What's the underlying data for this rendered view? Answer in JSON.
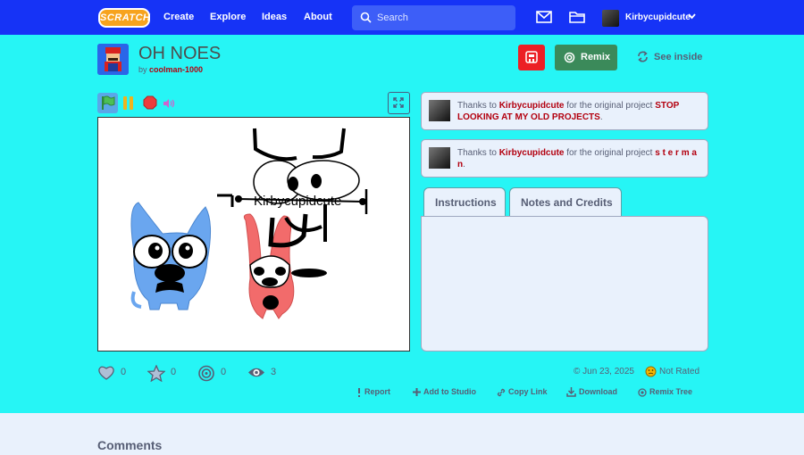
{
  "nav": {
    "logo": "SCRATCH",
    "links": [
      "Create",
      "Explore",
      "Ideas",
      "About"
    ],
    "search_placeholder": "Search",
    "username": "Kirbycupidcute"
  },
  "project": {
    "title": "OH NOES",
    "by_prefix": "by",
    "author": "coolman-1000",
    "remix_label": "Remix",
    "see_inside_label": "See inside"
  },
  "stage": {
    "sprite_text": "Kirbycupidcute"
  },
  "credits": [
    {
      "prefix": "Thanks to",
      "user": "Kirbycupidcute",
      "middle": "for the original project",
      "project": "STOP LOOKING AT MY OLD PROJECTS",
      "suffix": "."
    },
    {
      "prefix": "Thanks to",
      "user": "Kirbycupidcute",
      "middle": "for the original project",
      "project": "s t e r m a n",
      "suffix": "."
    }
  ],
  "tabs": [
    "Instructions",
    "Notes and Credits"
  ],
  "stats": {
    "loves": "0",
    "favorites": "0",
    "remixes": "0",
    "views": "3"
  },
  "date": "Jun 23, 2025",
  "rating": "Not Rated",
  "actions": [
    "Report",
    "Add to Studio",
    "Copy Link",
    "Download",
    "Remix Tree"
  ],
  "comments_title": "Comments",
  "colors": {
    "nav": "#1633f6",
    "background": "#26f5f5",
    "link_red": "#b3000f",
    "remix_green": "#3b8a5a"
  }
}
